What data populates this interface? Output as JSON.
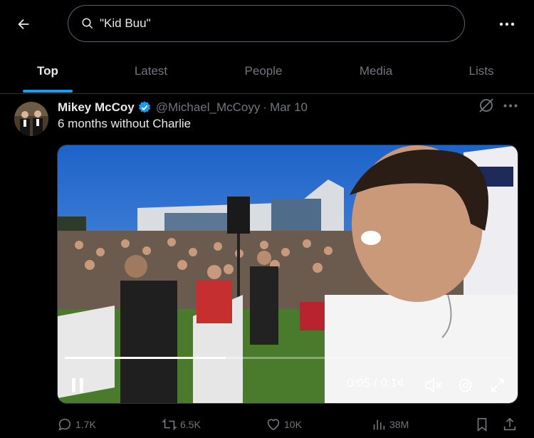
{
  "search": {
    "query": "\"Kid Buu\""
  },
  "icons": {
    "back": "arrow-left-icon",
    "search": "search-icon",
    "more": "more-horizontal-icon"
  },
  "tabs": [
    {
      "label": "Top",
      "active": true
    },
    {
      "label": "Latest",
      "active": false
    },
    {
      "label": "People",
      "active": false
    },
    {
      "label": "Media",
      "active": false
    },
    {
      "label": "Lists",
      "active": false
    }
  ],
  "post": {
    "display_name": "Mikey McCoy",
    "handle": "@Michael_McCoyy",
    "separator": "·",
    "date": "Mar 10",
    "text": "6 months without Charlie",
    "video": {
      "time_display": "0:05 / 0:14",
      "progress": 0.36,
      "state": "playing",
      "muted": true
    },
    "stats": {
      "replies": "1.7K",
      "reposts": "6.5K",
      "likes": "10K",
      "views": "38M"
    }
  },
  "colors": {
    "accent": "#1d9bf0",
    "muted_text": "#71767b",
    "text": "#e7e9ea",
    "border": "#2f3336"
  }
}
